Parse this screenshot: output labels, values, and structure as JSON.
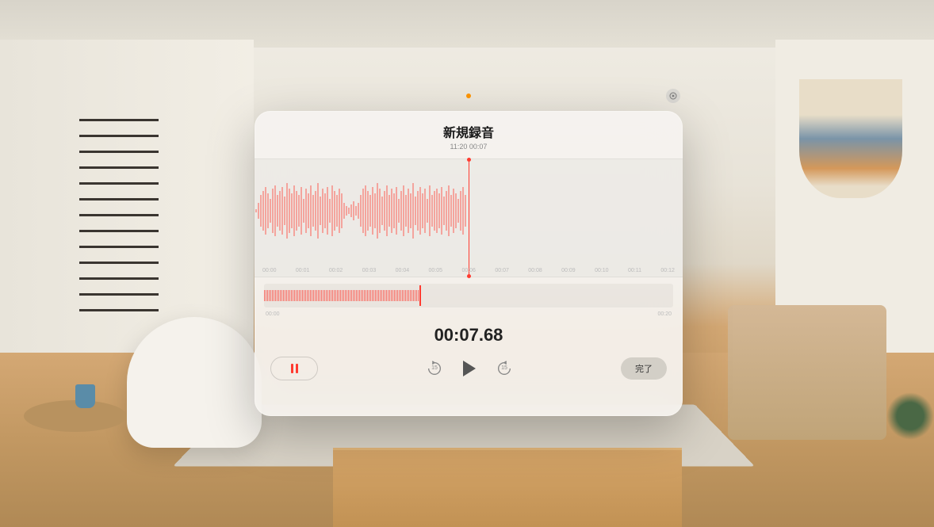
{
  "header": {
    "title": "新規録音",
    "subtitle": "11:20  00:07"
  },
  "waveform": {
    "ticks": [
      "00:00",
      "00:01",
      "00:02",
      "00:03",
      "00:04",
      "00:05",
      "00:06",
      "00:07",
      "00:08",
      "00:09",
      "00:10",
      "00:11",
      "00:12"
    ]
  },
  "mini": {
    "start": "00:00",
    "end": "00:20"
  },
  "elapsed": "00:07.68",
  "controls": {
    "skip_back": "15",
    "skip_fwd": "15",
    "done": "完了"
  },
  "colors": {
    "accent": "#ff3b30"
  }
}
